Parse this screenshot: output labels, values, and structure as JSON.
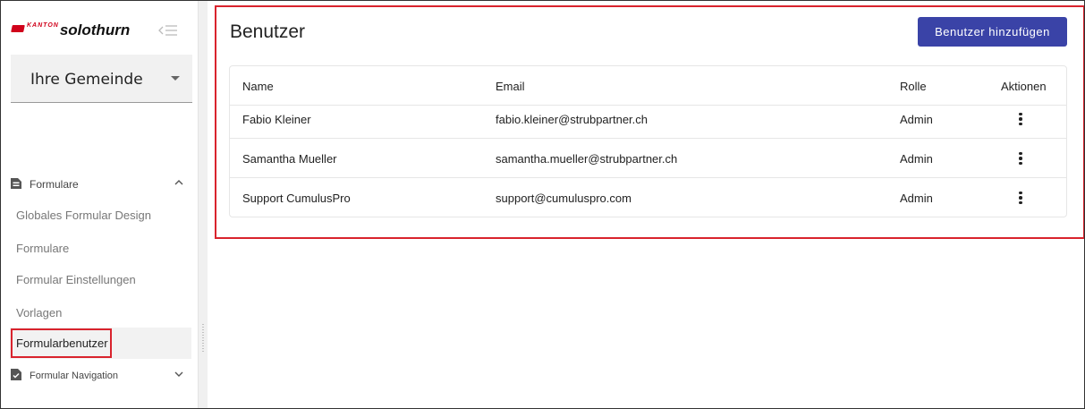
{
  "sidebar": {
    "logo": {
      "small": "KANTON",
      "name": "solothurn",
      "flag_color": "#d0021b"
    },
    "collapse_icon": "collapse-menu-icon",
    "municipality_select": {
      "value": "Ihre Gemeinde"
    },
    "section_forms": {
      "label": "Formulare",
      "icon": "document-icon",
      "expanded": true
    },
    "items": [
      {
        "label": "Globales Formular Design"
      },
      {
        "label": "Formulare"
      },
      {
        "label": "Formular Einstellungen"
      },
      {
        "label": "Vorlagen"
      },
      {
        "label": "Formularbenutzer",
        "active": true
      }
    ],
    "section_navigation": {
      "label": "Formular Navigation",
      "icon": "document-check-icon",
      "expanded": false
    }
  },
  "main": {
    "title": "Benutzer",
    "add_button": "Benutzer hinzufügen",
    "accent_color": "#3a43a7",
    "highlight_color": "#d9232d",
    "table": {
      "columns": [
        "Name",
        "Email",
        "Rolle",
        "Aktionen"
      ],
      "rows": [
        {
          "name": "Fabio Kleiner",
          "email": "fabio.kleiner@strubpartner.ch",
          "role": "Admin"
        },
        {
          "name": "Samantha Mueller",
          "email": "samantha.mueller@strubpartner.ch",
          "role": "Admin"
        },
        {
          "name": "Support CumulusPro",
          "email": "support@cumuluspro.com",
          "role": "Admin"
        }
      ]
    }
  }
}
